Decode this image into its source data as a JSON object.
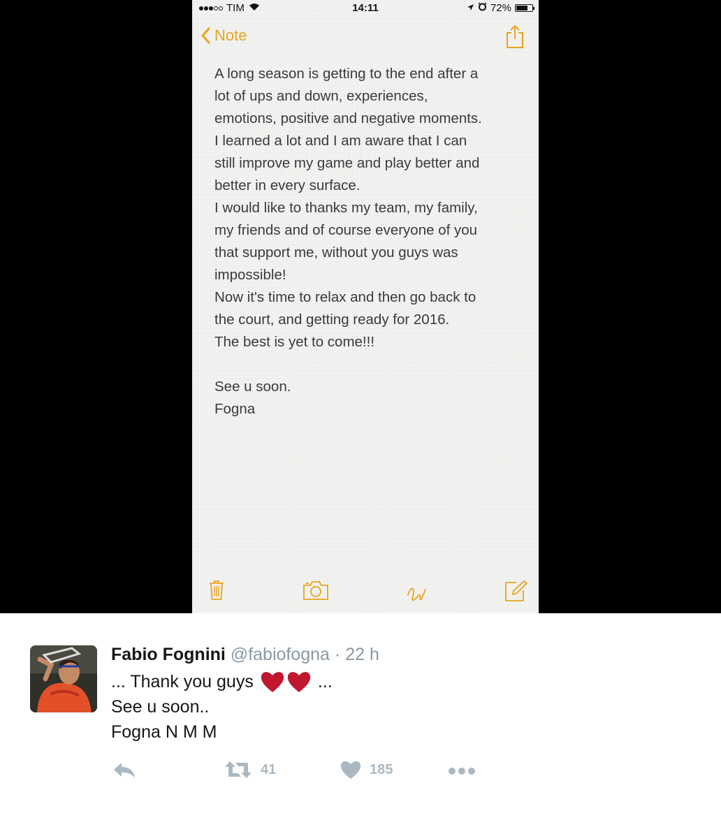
{
  "status_bar": {
    "carrier": "TIM",
    "time": "14:11",
    "battery": "72%",
    "battery_level": 0.72,
    "icons": [
      "signal-dots-icon",
      "wifi-icon",
      "location-arrow-icon",
      "alarm-icon",
      "battery-icon"
    ]
  },
  "nav": {
    "back_label": "Note",
    "accent_color": "#e6a51e",
    "icons": [
      "chevron-left-icon",
      "share-icon"
    ]
  },
  "note": {
    "lines": [
      "A long season is getting to the end after a",
      "lot of ups and down, experiences,",
      "emotions, positive and negative moments.",
      "I learned a lot and I am aware that I can",
      "still improve my game and play better and",
      "better in every surface.",
      "I would like to thanks my team, my family,",
      "my friends and of course everyone of you",
      "that support me, without you guys was",
      "impossible!",
      "Now it's time to relax and then go back to",
      "the court, and getting ready for 2016.",
      "The best is yet to come!!!",
      "",
      "See u soon.",
      "Fogna"
    ]
  },
  "toolbar": {
    "icons": [
      "trash-icon",
      "camera-icon",
      "sketch-icon",
      "compose-icon"
    ]
  },
  "tweet": {
    "author_name": "Fabio Fognini",
    "handle": "@fabiofogna",
    "time": "· 22 h",
    "line1_prefix": "... Thank you guys",
    "line1_suffix": "...",
    "line2": "See u soon..",
    "line3": "Fogna N M M",
    "heart_color": "#c0172f",
    "actions": {
      "retweets": "41",
      "likes": "185"
    }
  }
}
